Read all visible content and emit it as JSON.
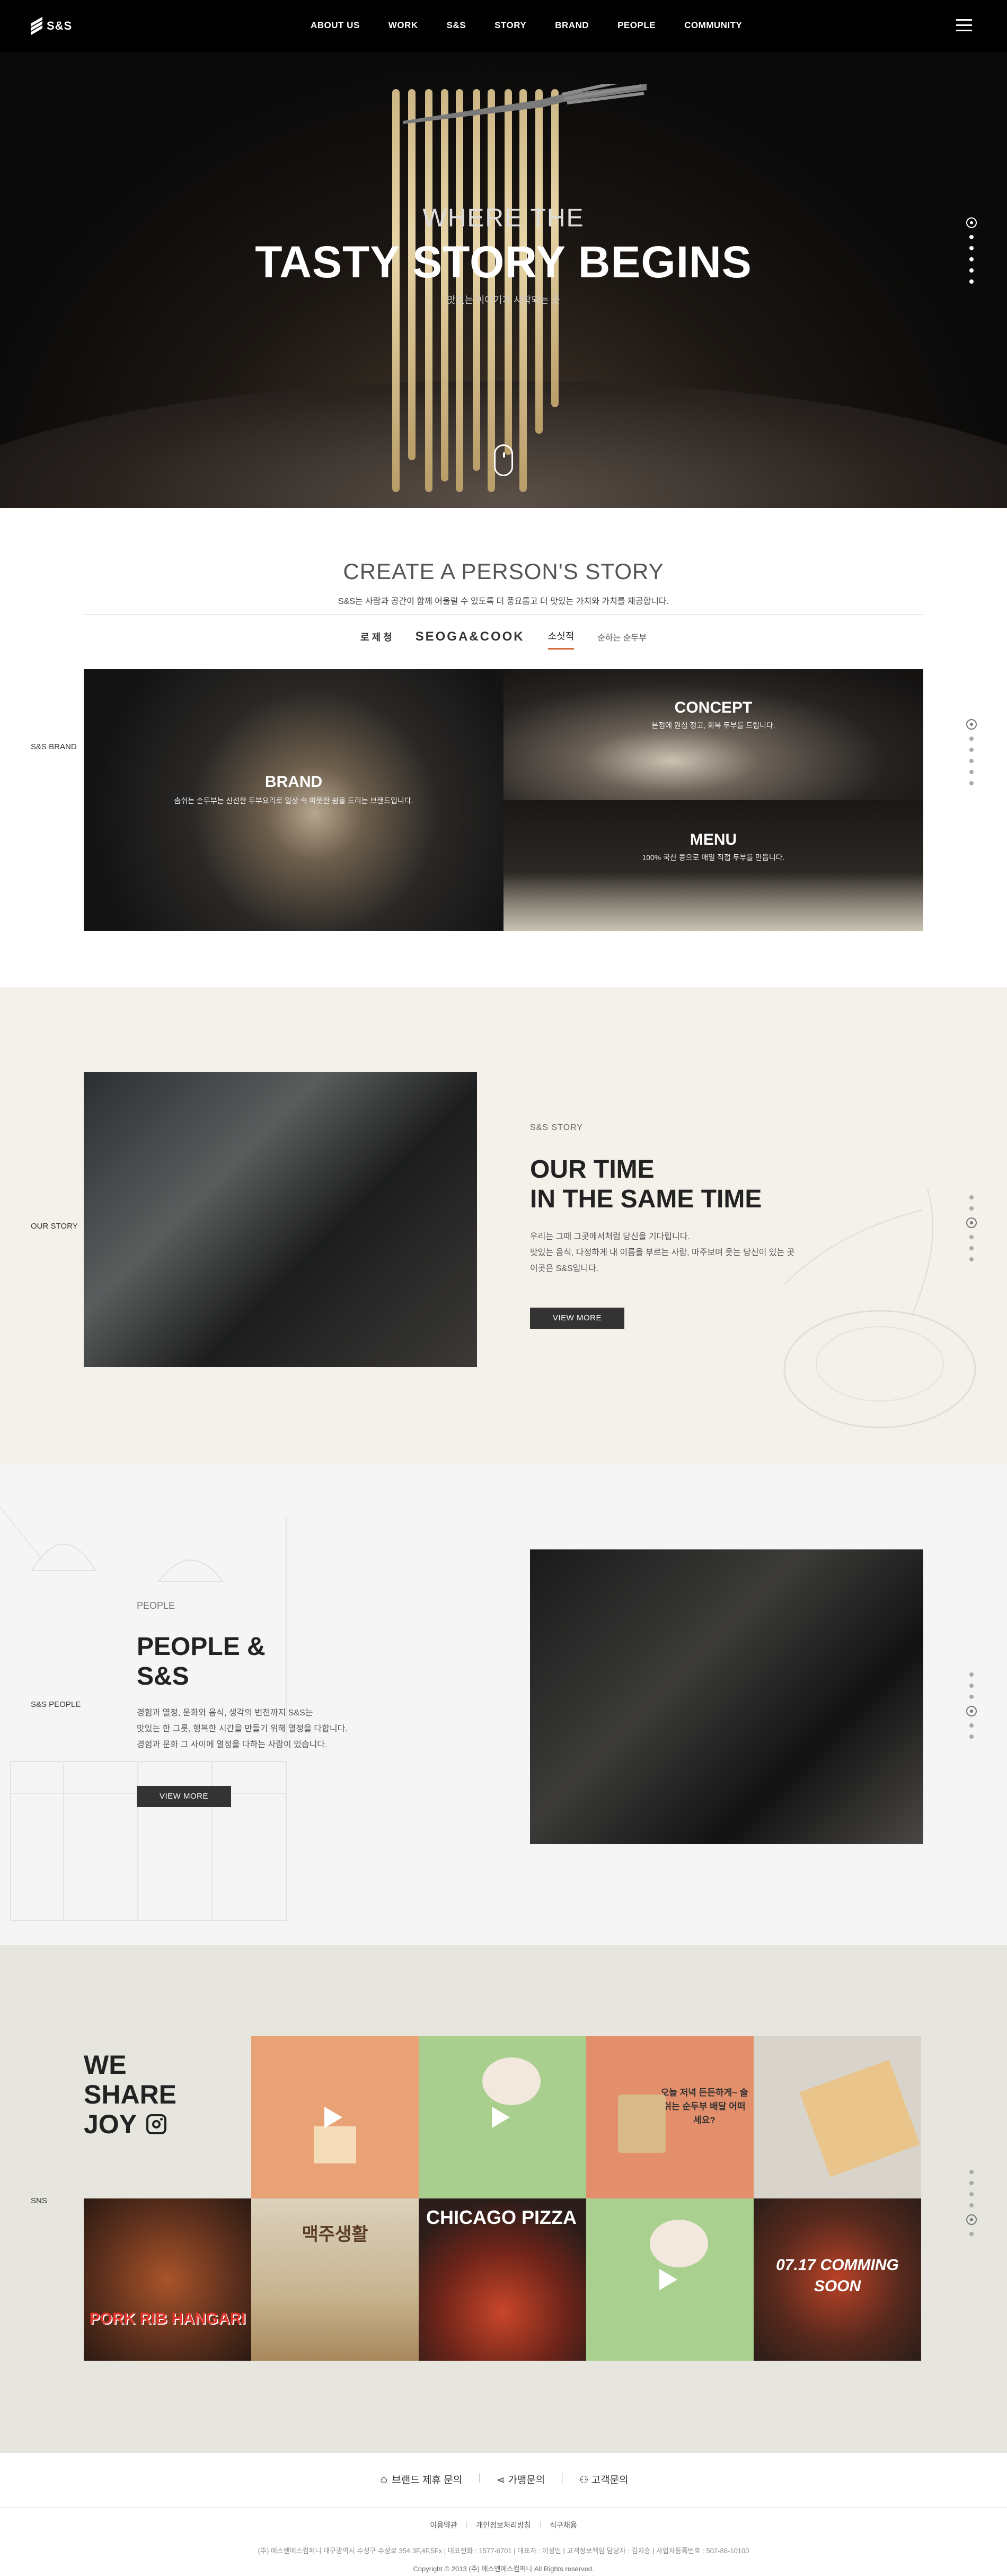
{
  "header": {
    "logo": "S&S",
    "nav": [
      "ABOUT US",
      "WORK",
      "S&S",
      "STORY",
      "BRAND",
      "PEOPLE",
      "COMMUNITY"
    ]
  },
  "hero": {
    "subtitle": "WHERE THE",
    "title": "TASTY STORY BEGINS",
    "caption": "맛있는 이야기가 시작되는 곳"
  },
  "brand": {
    "side_label": "S&S BRAND",
    "heading": "CREATE A PERSON'S STORY",
    "description": "S&S는 사람과 공간이 함께 어울릴 수 있도록 더 풍요롭고 더 맛있는 가치와 가치를 제공합니다.",
    "tabs": [
      "로 제 청",
      "SEOGA&COOK",
      "소싯적",
      "순하는 순두부"
    ],
    "tiles": [
      {
        "label": "BRAND",
        "text": "솜쉬는 손두부는 신선한 두부요리로 일상 속 따뜻한 쉼을 드리는 브랜드입니다."
      },
      {
        "label": "CONCEPT",
        "text": "본점에 원심 정고, 회복 두부를 드립니다."
      },
      {
        "label": "MENU",
        "text": "100% 국산 콩으로 매일 직접 두부를 만듭니다."
      }
    ]
  },
  "story": {
    "side_label": "OUR STORY",
    "tag": "S&S STORY",
    "title_lines": [
      "OUR TIME",
      "IN THE SAME TIME"
    ],
    "body_lines": [
      "우리는 그때 그곳에서처럼 당신을 기다립니다.",
      "맛있는 음식, 다정하게 내 이름을 부르는 사람, 마주보며 웃는 당신이 있는 곳",
      "이곳은 S&S입니다."
    ],
    "button": "VIEW MORE"
  },
  "people": {
    "side_label": "S&S PEOPLE",
    "tag": "PEOPLE",
    "title_lines": [
      "PEOPLE &",
      "S&S"
    ],
    "body_lines": [
      "경험과 열정, 문화와 음식, 생각의 번전까지 S&S는",
      "맛있는 한 그릇, 행복한 시간을 만들기 위해 열정을 다합니다.",
      "경험과 문화 그 사이에 열정을 다하는 사람이 있습니다."
    ],
    "button": "VIEW MORE"
  },
  "sns": {
    "side_label": "SNS",
    "title_lines": [
      "WE",
      "SHARE",
      "JOY"
    ],
    "posts": [
      {
        "caption": ""
      },
      {
        "caption": ""
      },
      {
        "caption": "오늘 저녁 든든하게~ 술쉬는 순두부 배달 어떠세요?"
      },
      {
        "caption": ""
      },
      {
        "caption": "PORK RIB HANGARI"
      },
      {
        "caption": "맥주생활"
      },
      {
        "caption": "CHICAGO PIZZA"
      },
      {
        "caption": ""
      },
      {
        "caption": "07.17 COMMING SOON"
      }
    ]
  },
  "footer": {
    "links": [
      "브랜드 제휴 문의",
      "가맹문의",
      "고객문의"
    ],
    "policy": [
      "이용약관",
      "개인정보처리방침",
      "식구채용"
    ],
    "info": "(주) 에스앤에스컴퍼니 대구광역시 수성구 수성로 354 3F,4F,5Fx | 대표전화 : 1577-6701 | 대표자 : 이성인 | 고객정보책임 담당자 : 김지승 | 사업자등록번호 : 502-86-10100",
    "copyright": "Copyright © 2013 (주) 에스앤에스컴퍼니 All Rights reserved."
  }
}
